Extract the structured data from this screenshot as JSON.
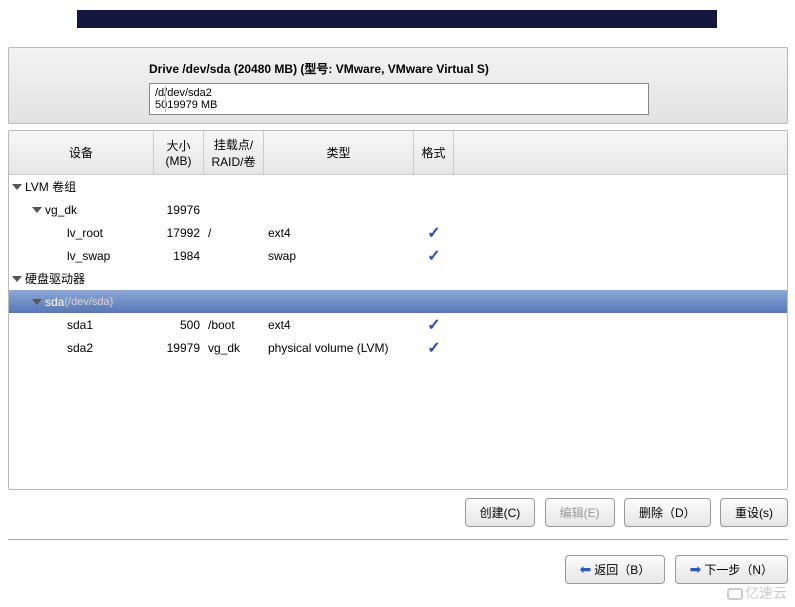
{
  "drive": {
    "title": "Drive /dev/sda (20480 MB) (型号: VMware, VMware Virtual S)",
    "box_line1": "/d/dev/sda2",
    "box_line2": "5019979 MB"
  },
  "columns": {
    "device": "设备",
    "size_l1": "大小",
    "size_l2": "(MB)",
    "mount_l1": "挂载点/",
    "mount_l2": "RAID/卷",
    "type": "类型",
    "format": "格式"
  },
  "groups": {
    "lvm": "LVM 卷组",
    "hdd": "硬盘驱动器"
  },
  "rows": {
    "vg_dk": {
      "dev": "vg_dk",
      "size": "19976",
      "mount": "",
      "type": "",
      "fmt": ""
    },
    "lv_root": {
      "dev": "lv_root",
      "size": "17992",
      "mount": "/",
      "type": "ext4",
      "fmt": "✓"
    },
    "lv_swap": {
      "dev": "lv_swap",
      "size": "1984",
      "mount": "",
      "type": "swap",
      "fmt": "✓"
    },
    "sda": {
      "dev": "sda",
      "path": "(/dev/sda)",
      "size": "",
      "mount": "",
      "type": "",
      "fmt": ""
    },
    "sda1": {
      "dev": "sda1",
      "size": "500",
      "mount": "/boot",
      "type": "ext4",
      "fmt": "✓"
    },
    "sda2": {
      "dev": "sda2",
      "size": "19979",
      "mount": "vg_dk",
      "type": "physical volume (LVM)",
      "fmt": "✓"
    }
  },
  "buttons": {
    "create": "创建(C)",
    "edit": "编辑(E)",
    "delete": "删除（D）",
    "reset": "重设(s)",
    "back": "返回（B）",
    "next": "下一步（N）"
  },
  "watermark": "亿速云"
}
